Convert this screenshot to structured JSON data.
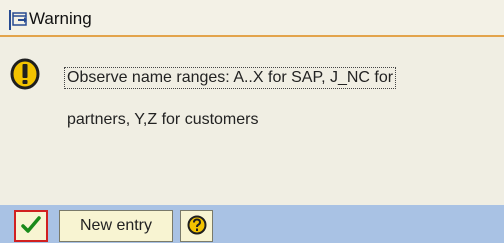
{
  "dialog": {
    "title": "Warning",
    "message_line1": "Observe name ranges: A..X for SAP, J_NC for",
    "message_line2": "partners, Y,Z for customers"
  },
  "toolbar": {
    "new_entry_label": "New entry"
  },
  "icons": {
    "title": "dialog-title-icon",
    "warning": "warning-icon",
    "ok": "checkmark-icon",
    "help": "help-icon"
  },
  "colors": {
    "toolbar_bg": "#a9c2e4",
    "title_accent": "#e3a44b",
    "warning_yellow": "#f3c300",
    "ok_green": "#1a8a1a",
    "focus_red": "#d12020"
  }
}
